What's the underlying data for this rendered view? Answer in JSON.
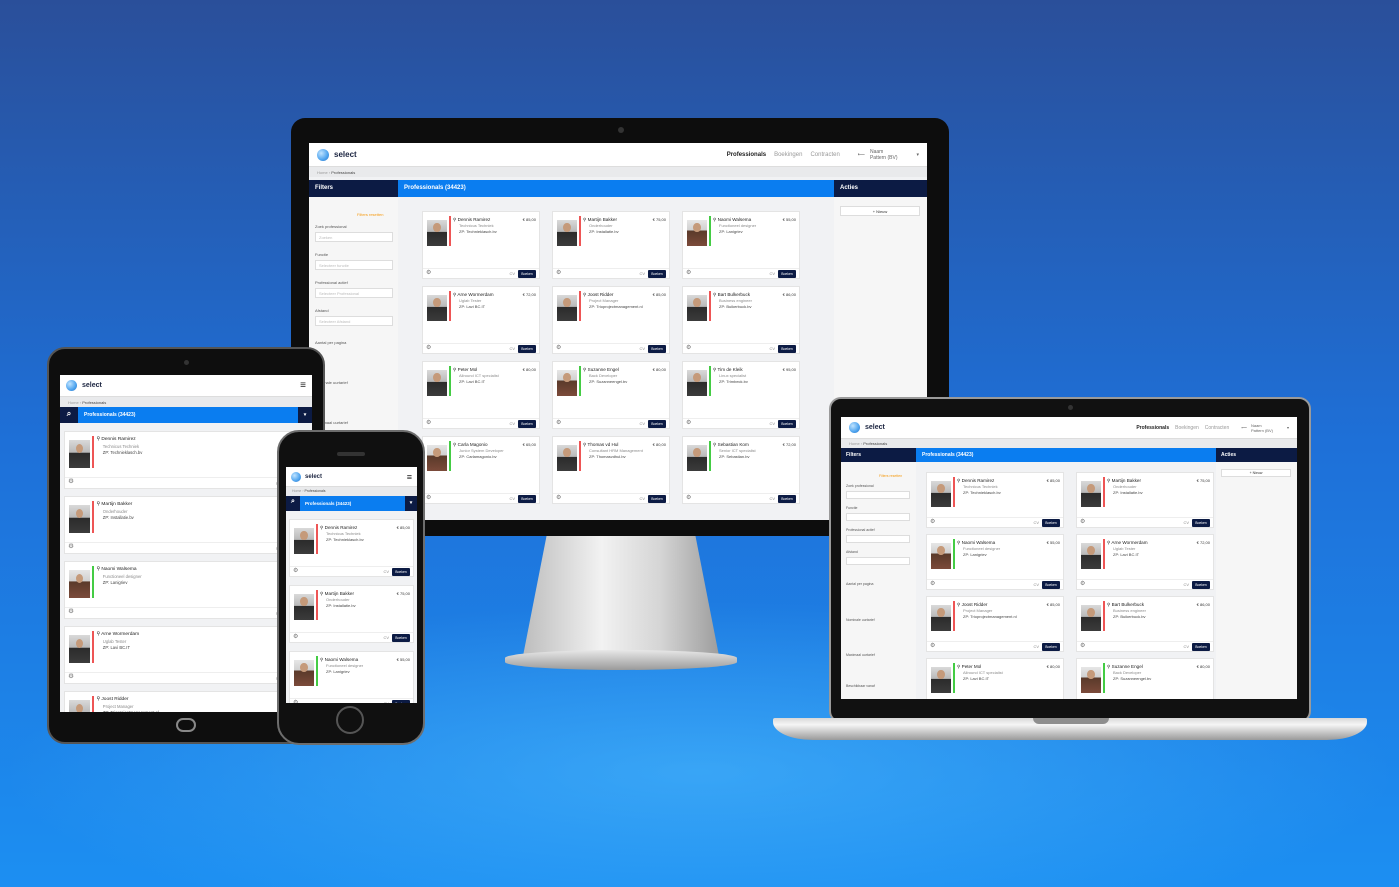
{
  "brand": "select",
  "nav": {
    "professionals": "Professionals",
    "bookings": "Boekingen",
    "contracts": "Contracten"
  },
  "user": {
    "name": "Naam",
    "subtitle": "Pattern (BV)"
  },
  "breadcrumb": {
    "home": "Home",
    "current": "Professionals"
  },
  "filters": {
    "title": "Filters",
    "reset": "Filters resetten",
    "search_label": "Zoek professional",
    "search_placeholder": "Zoeken",
    "function_label": "Functie",
    "function_placeholder": "Selecteer functie",
    "status_label": "Professional actief",
    "status_placeholder": "Selecteer Professional",
    "region_label": "Afstand",
    "region_placeholder": "Selecteer Afstand",
    "per_page": "Aantal per pagina",
    "hours_label": "Nominale uurtarief",
    "rate_label": "Maximaal uurtarief",
    "experience_label": "Beschikbaar vanaf"
  },
  "list_title": "Professionals (34423)",
  "actions": {
    "title": "Acties",
    "new_label": "+ Nieuw"
  },
  "book_label": "Boeken",
  "cv_label": "CV",
  "profiles": [
    {
      "name": "Dennis Ramirez",
      "rate": "€ 85,00",
      "role": "Technicus Techniek",
      "company": "Technieklasch.bv",
      "female": false,
      "strip": "#e55"
    },
    {
      "name": "Martijn Bakker",
      "rate": "€ 75,00",
      "role": "Onderhouder",
      "company": "Installatie.bv",
      "female": false,
      "strip": "#e55"
    },
    {
      "name": "Naomi Walsema",
      "rate": "€ 55,00",
      "role": "Functioneel designer",
      "company": "Lanigriev",
      "female": true,
      "strip": "#4c4"
    },
    {
      "name": "Arne Wormerdam",
      "rate": "€ 72,00",
      "role": "Uglab Tester",
      "company": "Lavi BC.IT",
      "female": false,
      "strip": "#e55"
    },
    {
      "name": "Joost Ridder",
      "rate": "€ 85,00",
      "role": "Project Manager",
      "company": "Trioprojectmanagement.nl",
      "female": false,
      "strip": "#e55"
    },
    {
      "name": "Bart Bulkerbuck",
      "rate": "€ 86,00",
      "role": "Business engineer",
      "company": "Buikerbuck.bv",
      "female": false,
      "strip": "#e55"
    },
    {
      "name": "Peter Mol",
      "rate": "€ 80,00",
      "role": "Allround ICT specialist",
      "company": "Lavi BC.IT",
      "female": false,
      "strip": "#4c4"
    },
    {
      "name": "Suzanne Engel",
      "rate": "€ 80,00",
      "role": "Back Developer",
      "company": "Suzanneengel.bv",
      "female": true,
      "strip": "#4c4"
    },
    {
      "name": "Tim de Kleik",
      "rate": "€ 95,00",
      "role": "Linux specialist",
      "company": "Trimbeck.bv",
      "female": false,
      "strip": "#4c4"
    },
    {
      "name": "Carla Magonio",
      "rate": "€ 65,00",
      "role": "Junior System Developer",
      "company": "Carlamagonio.bv",
      "female": true,
      "strip": "#4c4"
    },
    {
      "name": "Thomas vd Hul",
      "rate": "€ 80,00",
      "role": "Consultant HRM Management",
      "company": "Thomasvdhul.bv",
      "female": false,
      "strip": "#e55"
    },
    {
      "name": "Sebastian Kom",
      "rate": "€ 72,00",
      "role": "Senior ICT specialist",
      "company": "Sebastian.bv",
      "female": false,
      "strip": "#4c4"
    }
  ]
}
